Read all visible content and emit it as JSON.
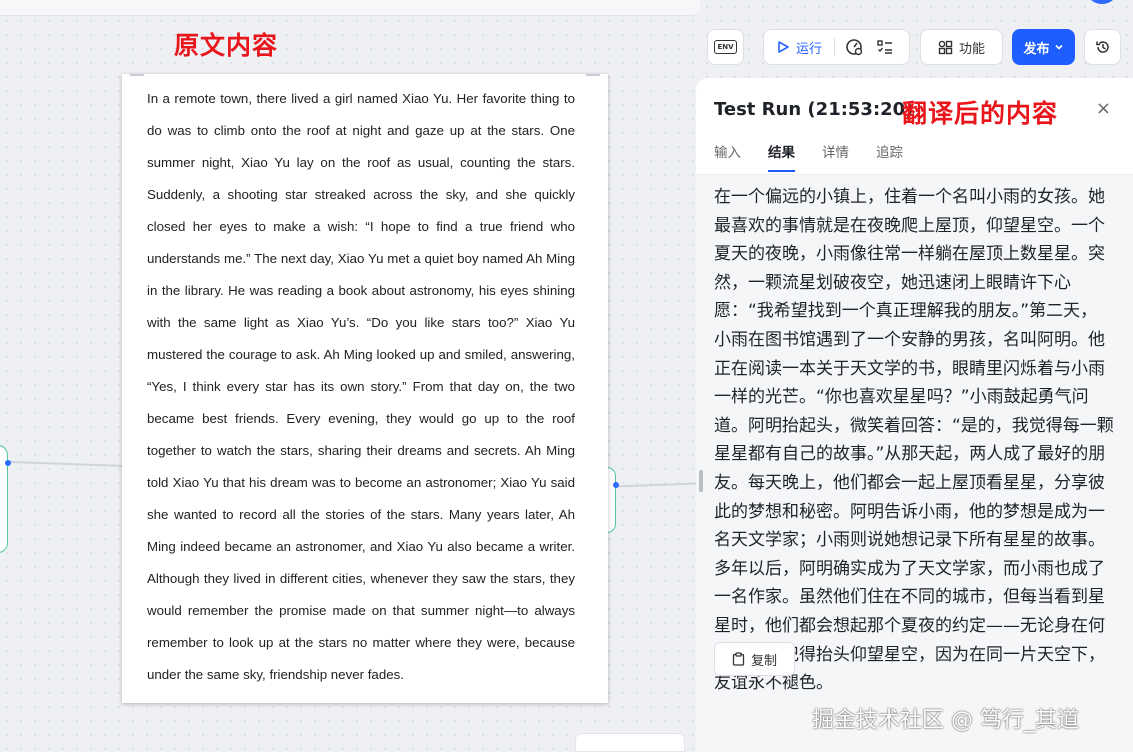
{
  "annotations": {
    "source_label": "原文内容",
    "target_label": "翻译后的内容"
  },
  "document": {
    "text": "In a remote town, there lived a girl named Xiao Yu. Her favorite thing to do was to climb onto the roof at night and gaze up at the stars. One summer night, Xiao Yu lay on the roof as usual, counting the stars. Suddenly, a shooting star streaked across the sky, and she quickly closed her eyes to make a wish: “I hope to find a true friend who understands me.” The next day, Xiao Yu met a quiet boy named Ah Ming in the library. He was reading a book about astronomy, his eyes shining with the same light as Xiao Yu’s. “Do you like stars too?” Xiao Yu mustered the courage to ask. Ah Ming looked up and smiled, answering, “Yes, I think every star has its own story.” From that day on, the two became best friends. Every evening, they would go up to the roof together to watch the stars, sharing their dreams and secrets. Ah Ming told Xiao Yu that his dream was to become an astronomer; Xiao Yu said she wanted to record all the stories of the stars. Many years later, Ah Ming indeed became an astronomer, and Xiao Yu also became a writer. Although they lived in different cities, whenever they saw the stars, they would remember the promise made on that summer night—to always remember to look up at the stars no matter where they were, because under the same sky, friendship never fades."
  },
  "toolbar": {
    "env_icon": "ENV",
    "run_label": "运行",
    "feature_label": "功能",
    "publish_label": "发布",
    "icons": [
      "env-icon",
      "play-icon",
      "gauge-icon",
      "checklist-icon",
      "grid-icon",
      "chevron-down-icon",
      "history-icon"
    ]
  },
  "panel": {
    "title": "Test Run (21:53:20)",
    "close_glyph": "×",
    "tabs": [
      {
        "label": "输入",
        "active": false
      },
      {
        "label": "结果",
        "active": true
      },
      {
        "label": "详情",
        "active": false
      },
      {
        "label": "追踪",
        "active": false
      }
    ],
    "result_text": "在一个偏远的小镇上，住着一个名叫小雨的女孩。她最喜欢的事情就是在夜晚爬上屋顶，仰望星空。一个夏天的夜晚，小雨像往常一样躺在屋顶上数星星。突然，一颗流星划破夜空，她迅速闭上眼睛许下心愿：“我希望找到一个真正理解我的朋友。”第二天，小雨在图书馆遇到了一个安静的男孩，名叫阿明。他正在阅读一本关于天文学的书，眼睛里闪烁着与小雨一样的光芒。“你也喜欢星星吗？”小雨鼓起勇气问道。阿明抬起头，微笑着回答：“是的，我觉得每一颗星星都有自己的故事。”从那天起，两人成了最好的朋友。每天晚上，他们都会一起上屋顶看星星，分享彼此的梦想和秘密。阿明告诉小雨，他的梦想是成为一名天文学家；小雨则说她想记录下所有星星的故事。多年以后，阿明确实成为了天文学家，而小雨也成了一名作家。虽然他们住在不同的城市，但每当看到星星时，他们都会想起那个夏夜的约定——无论身在何处，都要记得抬头仰望星空，因为在同一片天空下，友谊永不褪色。",
    "copy_label": "复制"
  },
  "watermark": "掘金技术社区 @ 笃行_其道",
  "colors": {
    "accent": "#1e5eff",
    "annotation": "#e8161b",
    "node_border": "#53c8a0"
  }
}
